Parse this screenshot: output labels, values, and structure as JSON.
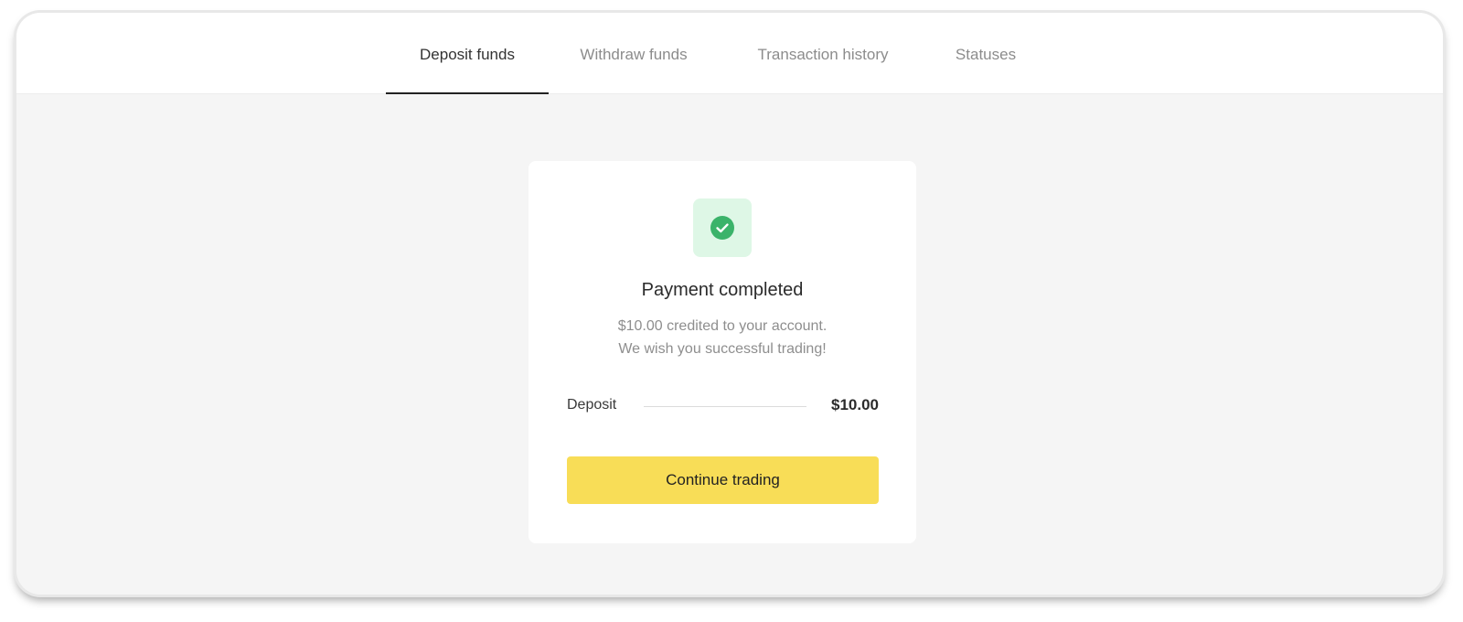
{
  "tabs": {
    "deposit": "Deposit funds",
    "withdraw": "Withdraw funds",
    "history": "Transaction history",
    "statuses": "Statuses",
    "active": "deposit"
  },
  "status_icon": {
    "name": "check-circle-icon",
    "color": "#3bb36a",
    "background": "#def7e6"
  },
  "payment": {
    "title": "Payment completed",
    "message_line1": "$10.00 credited to your account.",
    "message_line2": "We wish you successful trading!",
    "deposit_label": "Deposit",
    "deposit_amount": "$10.00"
  },
  "actions": {
    "continue_label": "Continue trading",
    "continue_color": "#f8dd57"
  }
}
